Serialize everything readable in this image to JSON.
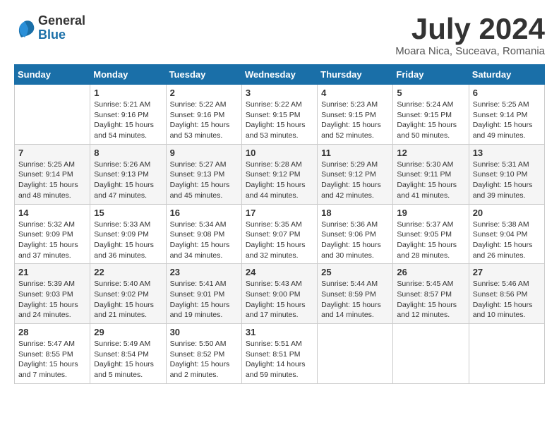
{
  "logo": {
    "general": "General",
    "blue": "Blue"
  },
  "title": "July 2024",
  "location": "Moara Nica, Suceava, Romania",
  "days_of_week": [
    "Sunday",
    "Monday",
    "Tuesday",
    "Wednesday",
    "Thursday",
    "Friday",
    "Saturday"
  ],
  "weeks": [
    [
      {
        "day": "",
        "info": ""
      },
      {
        "day": "1",
        "info": "Sunrise: 5:21 AM\nSunset: 9:16 PM\nDaylight: 15 hours\nand 54 minutes."
      },
      {
        "day": "2",
        "info": "Sunrise: 5:22 AM\nSunset: 9:16 PM\nDaylight: 15 hours\nand 53 minutes."
      },
      {
        "day": "3",
        "info": "Sunrise: 5:22 AM\nSunset: 9:15 PM\nDaylight: 15 hours\nand 53 minutes."
      },
      {
        "day": "4",
        "info": "Sunrise: 5:23 AM\nSunset: 9:15 PM\nDaylight: 15 hours\nand 52 minutes."
      },
      {
        "day": "5",
        "info": "Sunrise: 5:24 AM\nSunset: 9:15 PM\nDaylight: 15 hours\nand 50 minutes."
      },
      {
        "day": "6",
        "info": "Sunrise: 5:25 AM\nSunset: 9:14 PM\nDaylight: 15 hours\nand 49 minutes."
      }
    ],
    [
      {
        "day": "7",
        "info": "Sunrise: 5:25 AM\nSunset: 9:14 PM\nDaylight: 15 hours\nand 48 minutes."
      },
      {
        "day": "8",
        "info": "Sunrise: 5:26 AM\nSunset: 9:13 PM\nDaylight: 15 hours\nand 47 minutes."
      },
      {
        "day": "9",
        "info": "Sunrise: 5:27 AM\nSunset: 9:13 PM\nDaylight: 15 hours\nand 45 minutes."
      },
      {
        "day": "10",
        "info": "Sunrise: 5:28 AM\nSunset: 9:12 PM\nDaylight: 15 hours\nand 44 minutes."
      },
      {
        "day": "11",
        "info": "Sunrise: 5:29 AM\nSunset: 9:12 PM\nDaylight: 15 hours\nand 42 minutes."
      },
      {
        "day": "12",
        "info": "Sunrise: 5:30 AM\nSunset: 9:11 PM\nDaylight: 15 hours\nand 41 minutes."
      },
      {
        "day": "13",
        "info": "Sunrise: 5:31 AM\nSunset: 9:10 PM\nDaylight: 15 hours\nand 39 minutes."
      }
    ],
    [
      {
        "day": "14",
        "info": "Sunrise: 5:32 AM\nSunset: 9:09 PM\nDaylight: 15 hours\nand 37 minutes."
      },
      {
        "day": "15",
        "info": "Sunrise: 5:33 AM\nSunset: 9:09 PM\nDaylight: 15 hours\nand 36 minutes."
      },
      {
        "day": "16",
        "info": "Sunrise: 5:34 AM\nSunset: 9:08 PM\nDaylight: 15 hours\nand 34 minutes."
      },
      {
        "day": "17",
        "info": "Sunrise: 5:35 AM\nSunset: 9:07 PM\nDaylight: 15 hours\nand 32 minutes."
      },
      {
        "day": "18",
        "info": "Sunrise: 5:36 AM\nSunset: 9:06 PM\nDaylight: 15 hours\nand 30 minutes."
      },
      {
        "day": "19",
        "info": "Sunrise: 5:37 AM\nSunset: 9:05 PM\nDaylight: 15 hours\nand 28 minutes."
      },
      {
        "day": "20",
        "info": "Sunrise: 5:38 AM\nSunset: 9:04 PM\nDaylight: 15 hours\nand 26 minutes."
      }
    ],
    [
      {
        "day": "21",
        "info": "Sunrise: 5:39 AM\nSunset: 9:03 PM\nDaylight: 15 hours\nand 24 minutes."
      },
      {
        "day": "22",
        "info": "Sunrise: 5:40 AM\nSunset: 9:02 PM\nDaylight: 15 hours\nand 21 minutes."
      },
      {
        "day": "23",
        "info": "Sunrise: 5:41 AM\nSunset: 9:01 PM\nDaylight: 15 hours\nand 19 minutes."
      },
      {
        "day": "24",
        "info": "Sunrise: 5:43 AM\nSunset: 9:00 PM\nDaylight: 15 hours\nand 17 minutes."
      },
      {
        "day": "25",
        "info": "Sunrise: 5:44 AM\nSunset: 8:59 PM\nDaylight: 15 hours\nand 14 minutes."
      },
      {
        "day": "26",
        "info": "Sunrise: 5:45 AM\nSunset: 8:57 PM\nDaylight: 15 hours\nand 12 minutes."
      },
      {
        "day": "27",
        "info": "Sunrise: 5:46 AM\nSunset: 8:56 PM\nDaylight: 15 hours\nand 10 minutes."
      }
    ],
    [
      {
        "day": "28",
        "info": "Sunrise: 5:47 AM\nSunset: 8:55 PM\nDaylight: 15 hours\nand 7 minutes."
      },
      {
        "day": "29",
        "info": "Sunrise: 5:49 AM\nSunset: 8:54 PM\nDaylight: 15 hours\nand 5 minutes."
      },
      {
        "day": "30",
        "info": "Sunrise: 5:50 AM\nSunset: 8:52 PM\nDaylight: 15 hours\nand 2 minutes."
      },
      {
        "day": "31",
        "info": "Sunrise: 5:51 AM\nSunset: 8:51 PM\nDaylight: 14 hours\nand 59 minutes."
      },
      {
        "day": "",
        "info": ""
      },
      {
        "day": "",
        "info": ""
      },
      {
        "day": "",
        "info": ""
      }
    ]
  ]
}
